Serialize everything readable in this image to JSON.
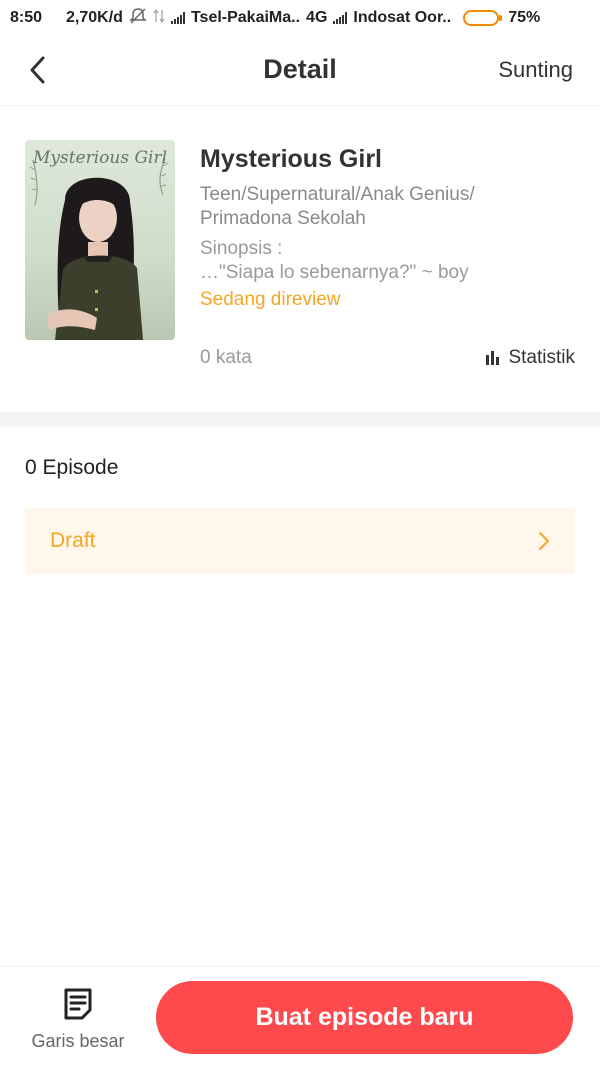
{
  "status_bar": {
    "time": "8:50",
    "net_speed": "2,70K/d",
    "carrier1": "Tsel-PakaiMa..",
    "network_type": "4G",
    "carrier2": "Indosat Oor..",
    "battery": "75%",
    "battery_level": 0.75,
    "icons": [
      "mute-icon",
      "data-arrows-icon",
      "signal-icon",
      "battery-icon"
    ]
  },
  "header": {
    "back_icon": "chevron-left-icon",
    "title": "Detail",
    "edit_label": "Sunting"
  },
  "book": {
    "cover_title": "Mysterious Girl",
    "title": "Mysterious Girl",
    "tags": "Teen/Supernatural/Anak Genius/ Primadona Sekolah",
    "synopsis_label": "Sinopsis :",
    "synopsis": "…\"Siapa lo sebenarnya?\" ~ boy",
    "status": "Sedang direview",
    "word_count": "0 kata",
    "stats_label": "Statistik",
    "stats_icon": "bar-chart-icon"
  },
  "episodes": {
    "count_label": "0 Episode",
    "draft_label": "Draft",
    "draft_icon": "chevron-right-icon"
  },
  "bottom": {
    "outline_label": "Garis besar",
    "outline_icon": "document-list-icon",
    "new_episode_label": "Buat episode baru"
  },
  "colors": {
    "accent_orange": "#f5a623",
    "primary_red": "#ff4a4d",
    "draft_bg": "#fff7ec"
  }
}
